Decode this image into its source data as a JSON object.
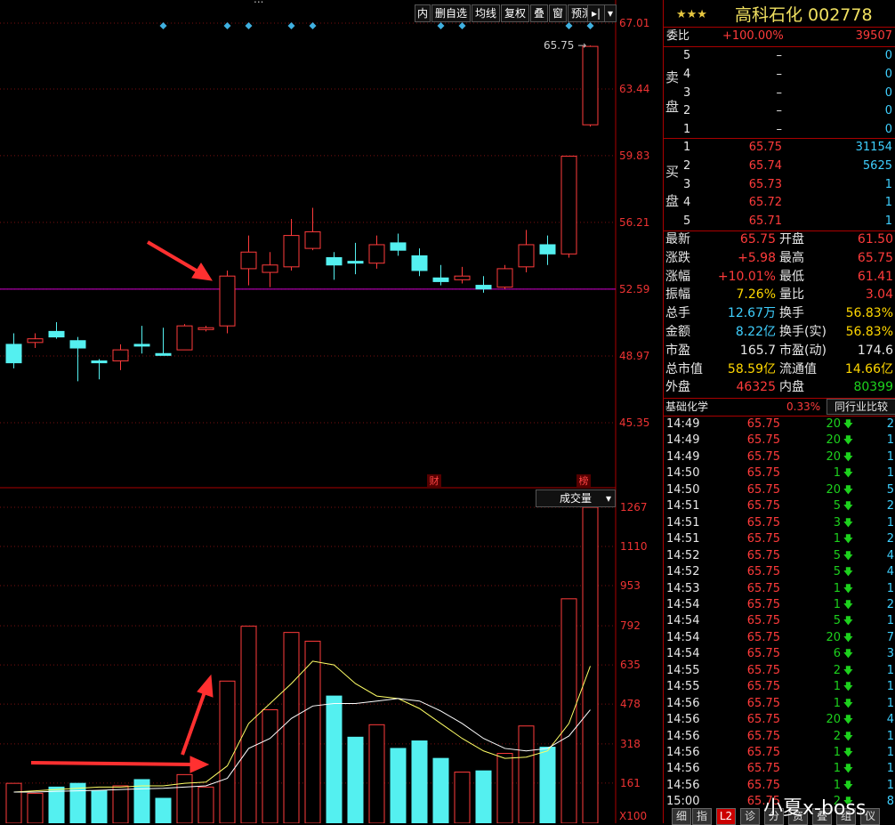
{
  "toolbar": {
    "truncated_title": "...",
    "buttons": [
      "内",
      "删自选",
      "均线",
      "复权",
      "叠",
      "窗",
      "预测"
    ],
    "arrow_end": "▸|",
    "dropdown": "▾"
  },
  "price_axis": [
    "67.01",
    "63.44",
    "59.83",
    "56.21",
    "52.59",
    "48.97",
    "45.35"
  ],
  "last_price_marker": "65.75",
  "markers": {
    "cai": "财",
    "bang": "榜"
  },
  "volume_selector": "成交量",
  "volume_axis": [
    "1267",
    "1110",
    "953",
    "792",
    "635",
    "478",
    "318",
    "161"
  ],
  "volume_unit": "X100",
  "chart_data": {
    "type": "candlestick+volume",
    "candles": [
      {
        "o": 49.6,
        "h": 50.2,
        "l": 48.3,
        "c": 48.6,
        "up": false
      },
      {
        "o": 49.7,
        "h": 50.2,
        "l": 49.4,
        "c": 49.9,
        "up": true
      },
      {
        "o": 50.3,
        "h": 50.8,
        "l": 49.9,
        "c": 50.0,
        "up": false
      },
      {
        "o": 49.8,
        "h": 50.0,
        "l": 47.6,
        "c": 49.4,
        "up": false
      },
      {
        "o": 48.7,
        "h": 48.8,
        "l": 47.7,
        "c": 48.6,
        "up": false
      },
      {
        "o": 48.7,
        "h": 49.6,
        "l": 48.2,
        "c": 49.3,
        "up": true
      },
      {
        "o": 49.6,
        "h": 50.6,
        "l": 49.1,
        "c": 49.6,
        "up": false
      },
      {
        "o": 49.1,
        "h": 50.5,
        "l": 49.0,
        "c": 49.0,
        "up": false
      },
      {
        "o": 49.3,
        "h": 50.7,
        "l": 49.3,
        "c": 50.6,
        "up": true
      },
      {
        "o": 50.5,
        "h": 50.6,
        "l": 50.3,
        "c": 50.4,
        "up": true
      },
      {
        "o": 50.6,
        "h": 53.6,
        "l": 50.2,
        "c": 53.3,
        "up": true
      },
      {
        "o": 53.7,
        "h": 55.5,
        "l": 52.8,
        "c": 54.6,
        "up": true
      },
      {
        "o": 53.5,
        "h": 54.6,
        "l": 52.7,
        "c": 53.9,
        "up": true
      },
      {
        "o": 53.8,
        "h": 56.4,
        "l": 53.6,
        "c": 55.5,
        "up": true
      },
      {
        "o": 54.8,
        "h": 57.0,
        "l": 54.7,
        "c": 55.7,
        "up": true
      },
      {
        "o": 54.3,
        "h": 54.6,
        "l": 53.1,
        "c": 53.9,
        "up": false
      },
      {
        "o": 54.1,
        "h": 55.1,
        "l": 53.4,
        "c": 54.0,
        "up": false
      },
      {
        "o": 54.0,
        "h": 55.5,
        "l": 53.7,
        "c": 55.0,
        "up": true
      },
      {
        "o": 55.1,
        "h": 55.6,
        "l": 54.4,
        "c": 54.7,
        "up": false
      },
      {
        "o": 54.4,
        "h": 54.8,
        "l": 53.3,
        "c": 53.6,
        "up": false
      },
      {
        "o": 53.2,
        "h": 53.9,
        "l": 52.8,
        "c": 53.0,
        "up": false
      },
      {
        "o": 53.1,
        "h": 53.8,
        "l": 52.9,
        "c": 53.3,
        "up": true
      },
      {
        "o": 52.8,
        "h": 53.3,
        "l": 52.4,
        "c": 52.6,
        "up": false
      },
      {
        "o": 52.7,
        "h": 53.9,
        "l": 52.6,
        "c": 53.7,
        "up": true
      },
      {
        "o": 53.8,
        "h": 55.8,
        "l": 53.5,
        "c": 55.0,
        "up": true
      },
      {
        "o": 55.0,
        "h": 55.5,
        "l": 53.9,
        "c": 54.5,
        "up": false
      },
      {
        "o": 54.5,
        "h": 59.8,
        "l": 54.3,
        "c": 59.8,
        "up": true
      },
      {
        "o": 61.5,
        "h": 65.8,
        "l": 61.4,
        "c": 65.75,
        "up": true
      }
    ],
    "volumes": [
      {
        "v": 160,
        "up": true
      },
      {
        "v": 120,
        "up": true
      },
      {
        "v": 145,
        "up": false
      },
      {
        "v": 160,
        "up": false
      },
      {
        "v": 130,
        "up": false
      },
      {
        "v": 150,
        "up": true
      },
      {
        "v": 175,
        "up": false
      },
      {
        "v": 100,
        "up": false
      },
      {
        "v": 195,
        "up": true
      },
      {
        "v": 145,
        "up": true
      },
      {
        "v": 570,
        "up": true
      },
      {
        "v": 790,
        "up": true
      },
      {
        "v": 455,
        "up": true
      },
      {
        "v": 765,
        "up": true
      },
      {
        "v": 730,
        "up": true
      },
      {
        "v": 510,
        "up": false
      },
      {
        "v": 345,
        "up": false
      },
      {
        "v": 395,
        "up": true
      },
      {
        "v": 300,
        "up": false
      },
      {
        "v": 330,
        "up": false
      },
      {
        "v": 260,
        "up": false
      },
      {
        "v": 205,
        "up": true
      },
      {
        "v": 210,
        "up": false
      },
      {
        "v": 280,
        "up": true
      },
      {
        "v": 390,
        "up": true
      },
      {
        "v": 305,
        "up": false
      },
      {
        "v": 900,
        "up": true
      },
      {
        "v": 1267,
        "up": true
      }
    ],
    "ma_short": [
      125,
      130,
      135,
      140,
      145,
      145,
      150,
      150,
      160,
      165,
      230,
      400,
      480,
      560,
      650,
      635,
      560,
      510,
      500,
      460,
      400,
      340,
      290,
      260,
      265,
      290,
      400,
      630
    ],
    "ma_long": [
      125,
      125,
      128,
      130,
      132,
      135,
      138,
      140,
      145,
      150,
      180,
      300,
      340,
      420,
      470,
      480,
      480,
      490,
      500,
      490,
      450,
      400,
      340,
      300,
      290,
      300,
      350,
      455
    ],
    "price_ylim": [
      43.0,
      67.8
    ],
    "volume_ylim": [
      0,
      1290
    ],
    "reference_line": 52.59
  },
  "panel": {
    "stars": "★★★",
    "title": "高科石化 002778",
    "weibi_label": "委比",
    "weibi_pct": "+100.00%",
    "weibi_val": "39507",
    "sell_label_1": "卖",
    "sell_label_2": "盘",
    "buy_label_1": "买",
    "buy_label_2": "盘",
    "sell": [
      {
        "lvl": "5",
        "price": "–",
        "vol": "0"
      },
      {
        "lvl": "4",
        "price": "–",
        "vol": "0"
      },
      {
        "lvl": "3",
        "price": "–",
        "vol": "0"
      },
      {
        "lvl": "2",
        "price": "–",
        "vol": "0"
      },
      {
        "lvl": "1",
        "price": "–",
        "vol": "0"
      }
    ],
    "buy": [
      {
        "lvl": "1",
        "price": "65.75",
        "vol": "31154"
      },
      {
        "lvl": "2",
        "price": "65.74",
        "vol": "5625"
      },
      {
        "lvl": "3",
        "price": "65.73",
        "vol": "1"
      },
      {
        "lvl": "4",
        "price": "65.72",
        "vol": "1"
      },
      {
        "lvl": "5",
        "price": "65.71",
        "vol": "1"
      }
    ],
    "stats": [
      {
        "l1": "最新",
        "v1": "65.75",
        "c1": "red",
        "l2": "开盘",
        "v2": "61.50",
        "c2": "red"
      },
      {
        "l1": "涨跌",
        "v1": "+5.98",
        "c1": "red",
        "l2": "最高",
        "v2": "65.75",
        "c2": "red"
      },
      {
        "l1": "涨幅",
        "v1": "+10.01%",
        "c1": "red",
        "l2": "最低",
        "v2": "61.41",
        "c2": "red"
      },
      {
        "l1": "振幅",
        "v1": "7.26%",
        "c1": "yel",
        "l2": "量比",
        "v2": "3.04",
        "c2": "red"
      },
      {
        "l1": "总手",
        "v1": "12.67万",
        "c1": "cyn",
        "l2": "换手",
        "v2": "56.83%",
        "c2": "yel"
      },
      {
        "l1": "金额",
        "v1": "8.22亿",
        "c1": "cyn",
        "l2": "换手(实)",
        "v2": "56.83%",
        "c2": "yel"
      },
      {
        "l1": "市盈",
        "v1": "165.7",
        "c1": "wht",
        "l2": "市盈(动)",
        "v2": "174.6",
        "c2": "wht"
      },
      {
        "l1": "总市值",
        "v1": "58.59亿",
        "c1": "yel",
        "l2": "流通值",
        "v2": "14.66亿",
        "c2": "yel"
      },
      {
        "l1": "外盘",
        "v1": "46325",
        "c1": "red",
        "l2": "内盘",
        "v2": "80399",
        "c2": "grn"
      }
    ],
    "sector_name": "基础化学",
    "sector_pct": "0.33%",
    "sector_compare": "同行业比较",
    "ticks": [
      {
        "t": "14:49",
        "p": "65.75",
        "v": "20",
        "n": "2"
      },
      {
        "t": "14:49",
        "p": "65.75",
        "v": "20",
        "n": "1"
      },
      {
        "t": "14:49",
        "p": "65.75",
        "v": "20",
        "n": "1"
      },
      {
        "t": "14:50",
        "p": "65.75",
        "v": "1",
        "n": "1"
      },
      {
        "t": "14:50",
        "p": "65.75",
        "v": "20",
        "n": "5"
      },
      {
        "t": "14:51",
        "p": "65.75",
        "v": "5",
        "n": "2"
      },
      {
        "t": "14:51",
        "p": "65.75",
        "v": "3",
        "n": "1"
      },
      {
        "t": "14:51",
        "p": "65.75",
        "v": "1",
        "n": "2"
      },
      {
        "t": "14:52",
        "p": "65.75",
        "v": "5",
        "n": "4"
      },
      {
        "t": "14:52",
        "p": "65.75",
        "v": "5",
        "n": "4"
      },
      {
        "t": "14:53",
        "p": "65.75",
        "v": "1",
        "n": "1"
      },
      {
        "t": "14:54",
        "p": "65.75",
        "v": "1",
        "n": "2"
      },
      {
        "t": "14:54",
        "p": "65.75",
        "v": "5",
        "n": "1"
      },
      {
        "t": "14:54",
        "p": "65.75",
        "v": "20",
        "n": "7"
      },
      {
        "t": "14:54",
        "p": "65.75",
        "v": "6",
        "n": "3"
      },
      {
        "t": "14:55",
        "p": "65.75",
        "v": "2",
        "n": "1"
      },
      {
        "t": "14:55",
        "p": "65.75",
        "v": "1",
        "n": "1"
      },
      {
        "t": "14:56",
        "p": "65.75",
        "v": "1",
        "n": "1"
      },
      {
        "t": "14:56",
        "p": "65.75",
        "v": "20",
        "n": "4"
      },
      {
        "t": "14:56",
        "p": "65.75",
        "v": "2",
        "n": "1"
      },
      {
        "t": "14:56",
        "p": "65.75",
        "v": "1",
        "n": "1"
      },
      {
        "t": "14:56",
        "p": "65.75",
        "v": "1",
        "n": "1"
      },
      {
        "t": "14:56",
        "p": "65.75",
        "v": "1",
        "n": "1"
      },
      {
        "t": "15:00",
        "p": "65.75",
        "v": "2",
        "n": "8"
      }
    ],
    "bottom_tabs": [
      "细",
      "指",
      "L2",
      "诊",
      "分",
      "资",
      "叠",
      "组",
      "仪"
    ],
    "watermark": "小夏x-boss"
  }
}
